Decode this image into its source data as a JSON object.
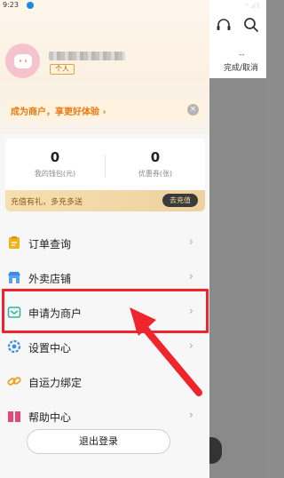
{
  "status_bar": {
    "time": "9:23"
  },
  "header": {
    "tag": "个人",
    "banner_text": "成为商户，享更好体验 ›",
    "close_symbol": "×"
  },
  "wallet": {
    "balance_value": "0",
    "balance_label": "我的钱包(元)",
    "coupon_value": "0",
    "coupon_label": "优惠券(张)",
    "promo_text": "充值有礼，多充多送",
    "recharge_button": "去充值"
  },
  "menu": [
    {
      "label": "订单查询",
      "icon": "order-icon"
    },
    {
      "label": "外卖店铺",
      "icon": "shop-icon"
    },
    {
      "label": "申请为商户",
      "icon": "merchant-icon"
    },
    {
      "label": "设置中心",
      "icon": "settings-icon"
    },
    {
      "label": "自运力绑定",
      "icon": "link-icon"
    },
    {
      "label": "帮助中心",
      "icon": "help-icon"
    }
  ],
  "chevron": "›",
  "logout_button": "退出登录",
  "right_panel": {
    "dash": "--",
    "done_cancel": "完成/取消"
  },
  "colors": {
    "accent": "#ea7b12",
    "highlight": "#f0242c",
    "avatar": "#f5c3cd"
  }
}
